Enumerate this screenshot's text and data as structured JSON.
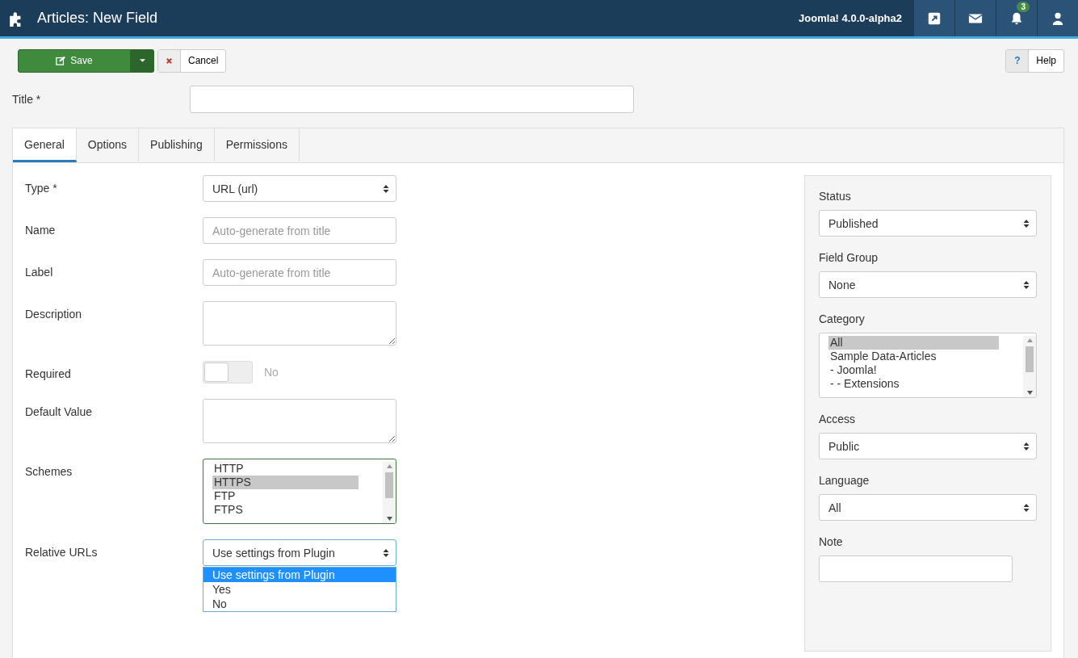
{
  "header": {
    "title": "Articles: New Field",
    "version": "Joomla! 4.0.0-alpha2",
    "buttons": [
      {
        "kind": "external"
      },
      {
        "kind": "mail"
      },
      {
        "kind": "bell",
        "badge": "3"
      },
      {
        "kind": "user"
      }
    ]
  },
  "toolbar": {
    "save": "Save",
    "cancel": "Cancel",
    "help_mark": "?",
    "help": "Help"
  },
  "title_field": {
    "label": "Title *"
  },
  "tabs": [
    {
      "label": "General",
      "selected": true
    },
    {
      "label": "Options",
      "selected": false
    },
    {
      "label": "Publishing",
      "selected": false
    },
    {
      "label": "Permissions",
      "selected": false
    }
  ],
  "fields": [
    {
      "label": "Type *",
      "kind": "select",
      "value": "URL (url)"
    },
    {
      "label": "Name",
      "kind": "text",
      "placeholder": "Auto-generate from title"
    },
    {
      "label": "Label",
      "kind": "text",
      "placeholder": "Auto-generate from title"
    },
    {
      "label": "Description",
      "kind": "textarea"
    },
    {
      "label": "Required",
      "kind": "toggle",
      "on": false,
      "state_label": "No"
    },
    {
      "label": "Default Value",
      "kind": "textarea"
    },
    {
      "label": "Schemes",
      "kind": "listbox",
      "options": [
        {
          "label": "HTTP",
          "selected": false
        },
        {
          "label": "HTTPS",
          "selected": true
        },
        {
          "label": "FTP",
          "selected": false
        },
        {
          "label": "FTPS",
          "selected": false
        }
      ]
    },
    {
      "label": "Relative URLs",
      "kind": "select",
      "value": "Use settings from Plugin",
      "expanded": true,
      "options": [
        {
          "label": "Use settings from Plugin",
          "selected": true
        },
        {
          "label": "Yes",
          "selected": false
        },
        {
          "label": "No",
          "selected": false
        }
      ]
    }
  ],
  "sidebar": [
    {
      "label": "Status",
      "kind": "select",
      "value": "Published"
    },
    {
      "label": "Field Group",
      "kind": "select",
      "value": "None"
    },
    {
      "label": "Category",
      "kind": "listbox",
      "options": [
        {
          "label": "All",
          "selected": true
        },
        {
          "label": "Sample Data-Articles",
          "selected": false
        },
        {
          "label": "- Joomla!",
          "selected": false
        },
        {
          "label": "- - Extensions",
          "selected": false
        }
      ]
    },
    {
      "label": "Access",
      "kind": "select",
      "value": "Public"
    },
    {
      "label": "Language",
      "kind": "select",
      "value": "All"
    },
    {
      "label": "Note",
      "kind": "text"
    }
  ]
}
